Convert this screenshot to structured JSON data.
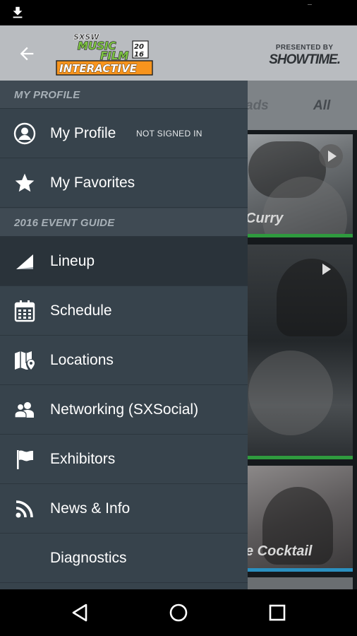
{
  "status_bar": {
    "download_icon": "download-icon"
  },
  "header": {
    "back_icon": "arrow-left-icon",
    "logo_text": {
      "line1": "SXSW",
      "line2": "MUSIC",
      "line3": "FILM",
      "year_top": "20",
      "year_bottom": "16",
      "line4": "INTERACTIVE"
    },
    "presented_by": "PRESENTED BY",
    "sponsor": "SHOWTIME."
  },
  "background": {
    "tabs": {
      "partial": "ads",
      "all": "All"
    },
    "cards": [
      {
        "title": "Curry"
      },
      {
        "title": ""
      },
      {
        "title": "e Cocktail"
      }
    ]
  },
  "drawer": {
    "sections": [
      {
        "header": "MY PROFILE",
        "items": [
          {
            "label": "My Profile",
            "sub": "NOT SIGNED IN",
            "icon": "user-circle-icon"
          },
          {
            "label": "My Favorites",
            "icon": "star-icon"
          }
        ]
      },
      {
        "header": "2016 EVENT GUIDE",
        "items": [
          {
            "label": "Lineup",
            "icon": "lineup-icon",
            "active": true
          },
          {
            "label": "Schedule",
            "icon": "calendar-icon"
          },
          {
            "label": "Locations",
            "icon": "map-pin-icon"
          },
          {
            "label": "Networking (SXSocial)",
            "icon": "people-icon"
          },
          {
            "label": "Exhibitors",
            "icon": "flag-icon"
          },
          {
            "label": "News & Info",
            "icon": "rss-icon"
          },
          {
            "label": "Diagnostics",
            "icon": ""
          }
        ]
      }
    ]
  },
  "colors": {
    "drawer_bg": "#37434c",
    "drawer_active": "#2a333a",
    "header_bg": "#b9bcc0",
    "logo_green": "#7cc242",
    "logo_orange": "#f7941d",
    "accent_green": "#2f9a3e",
    "accent_blue": "#2a8fbf"
  },
  "system_nav": {
    "back_icon": "nav-back-icon",
    "home_icon": "nav-home-icon",
    "recents_icon": "nav-recents-icon"
  }
}
